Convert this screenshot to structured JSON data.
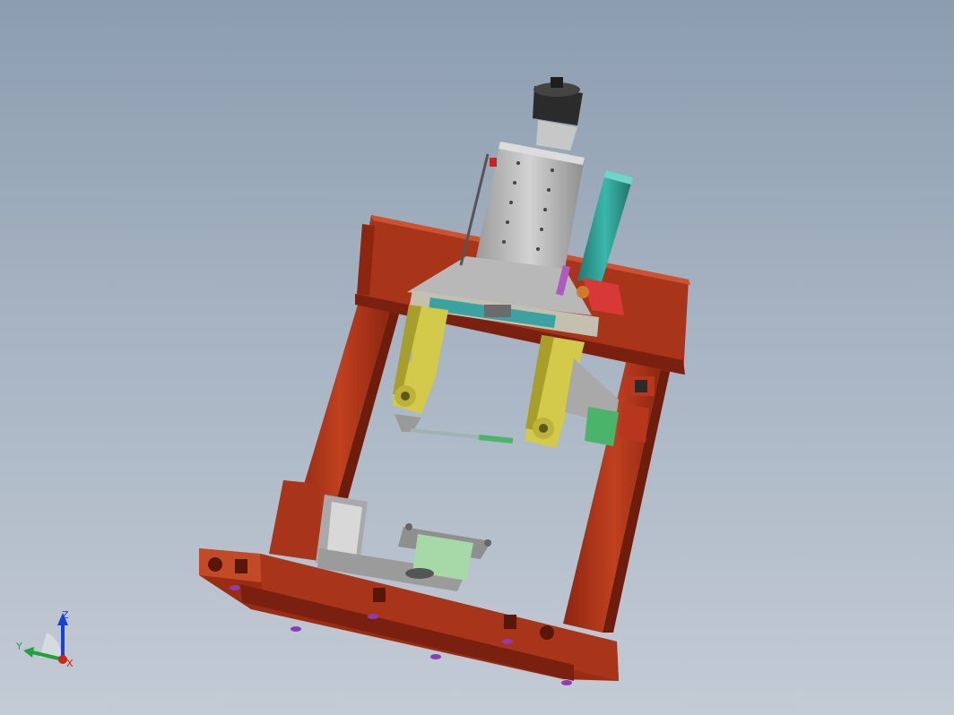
{
  "viewport": {
    "background_top": "#8c9db0",
    "background_bottom": "#c3cbd5"
  },
  "model": {
    "frame_color": "#b7361d",
    "bracket_color": "#d3c94a",
    "carriage_color": "#a9a9a9",
    "cylinder_color": "#2f9e94",
    "motor_color": "#2b2b2b",
    "accent_color": "#4ab56a"
  },
  "triad": {
    "x_label": "X",
    "y_label": "Y",
    "z_label": "Z",
    "x_color": "#d21f1f",
    "y_color": "#22a33a",
    "z_color": "#1f3fd2"
  }
}
